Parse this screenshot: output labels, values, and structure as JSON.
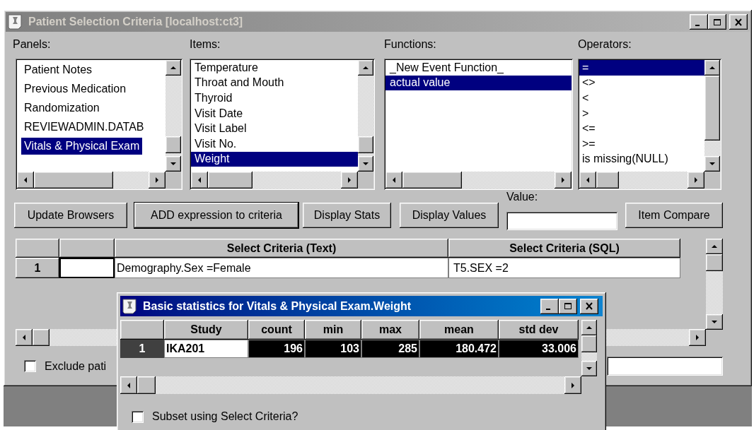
{
  "window": {
    "title": "Patient Selection Criteria [localhost:ct3]",
    "active": false
  },
  "lists": [
    {
      "label": "Panels:",
      "items": [
        {
          "text": "Patient Notes",
          "selected": false
        },
        {
          "text": "Previous Medication",
          "selected": false
        },
        {
          "text": "Randomization",
          "selected": false
        },
        {
          "text": "REVIEWADMIN.DATAB",
          "selected": false
        },
        {
          "text": "Vitals & Physical Exam",
          "selected": true
        }
      ]
    },
    {
      "label": "Items:",
      "items": [
        {
          "text": "Temperature",
          "selected": false
        },
        {
          "text": "Throat and Mouth",
          "selected": false
        },
        {
          "text": "Thyroid",
          "selected": false
        },
        {
          "text": "Visit Date",
          "selected": false
        },
        {
          "text": "Visit Label",
          "selected": false
        },
        {
          "text": "Visit No.",
          "selected": false
        },
        {
          "text": "Weight",
          "selected": true
        }
      ]
    },
    {
      "label": "Functions:",
      "items": [
        {
          "text": "_New Event Function_",
          "selected": false
        },
        {
          "text": "actual value",
          "selected": true
        }
      ]
    },
    {
      "label": "Operators:",
      "items": [
        {
          "text": "=",
          "selected": true
        },
        {
          "text": "<>",
          "selected": false
        },
        {
          "text": "<",
          "selected": false
        },
        {
          "text": ">",
          "selected": false
        },
        {
          "text": "<=",
          "selected": false
        },
        {
          "text": ">=",
          "selected": false
        },
        {
          "text": "is missing(NULL)",
          "selected": false
        }
      ]
    }
  ],
  "buttons": [
    {
      "label": "Update Browsers",
      "default": false
    },
    {
      "label": "ADD expression to criteria",
      "default": true
    },
    {
      "label": "Display Stats",
      "default": false
    },
    {
      "label": "Display Values",
      "default": false
    }
  ],
  "value_field": {
    "label": "Value:"
  },
  "compare_button": {
    "label": "Item Compare"
  },
  "criteria_grid": {
    "columns": [
      "Select Criteria (Text)",
      "Select Criteria (SQL)"
    ],
    "rows": [
      {
        "number": "1",
        "text": "Demography.Sex =Female",
        "sql": "T5.SEX =2"
      }
    ]
  },
  "exclude_checkbox": {
    "label": "Exclude pati",
    "checked": false
  },
  "stats_dialog": {
    "title": "Basic statistics for Vitals & Physical Exam.Weight",
    "active": true,
    "columns": [
      "Study",
      "count",
      "min",
      "max",
      "mean",
      "std dev"
    ],
    "rows": [
      {
        "number": "1",
        "selected": true,
        "cells": [
          "IKA201",
          "196",
          "103",
          "285",
          "180.472",
          "33.006"
        ]
      }
    ],
    "subset_checkbox": {
      "label": "Subset using Select Criteria?",
      "checked": false
    }
  }
}
